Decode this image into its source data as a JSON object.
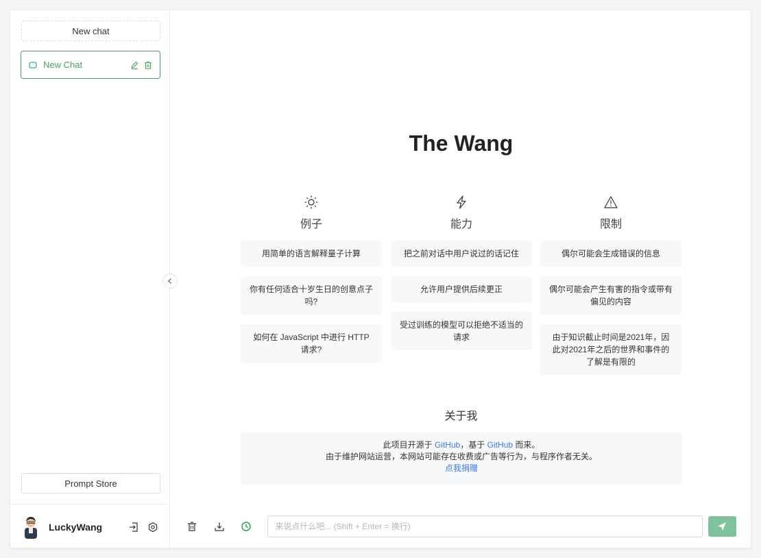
{
  "sidebar": {
    "new_chat_label": "New chat",
    "history": [
      {
        "label": "New Chat"
      }
    ],
    "prompt_store_label": "Prompt Store",
    "user": {
      "name": "LuckyWang"
    }
  },
  "main": {
    "title": "The Wang",
    "columns": [
      {
        "icon": "sun-icon",
        "title": "例子",
        "cards": [
          "用简单的语言解释量子计算",
          "你有任何适合十岁生日的创意点子吗?",
          "如何在 JavaScript 中进行 HTTP 请求?"
        ]
      },
      {
        "icon": "lightning-icon",
        "title": "能力",
        "cards": [
          "把之前对话中用户说过的话记住",
          "允许用户提供后续更正",
          "受过训练的模型可以拒绝不适当的请求"
        ]
      },
      {
        "icon": "warning-icon",
        "title": "限制",
        "cards": [
          "偶尔可能会生成错误的信息",
          "偶尔可能会产生有害的指令或带有偏见的内容",
          "由于知识截止时间是2021年，因此对2021年之后的世界和事件的了解是有限的"
        ]
      }
    ],
    "about": {
      "title": "关于我",
      "line1_prefix": "此项目开源于 ",
      "line1_link1": "GitHub",
      "line1_mid": "，基于 ",
      "line1_link2": "GitHub",
      "line1_suffix": " 而来。",
      "line2": "由于维护网站运营，本网站可能存在收费或广告等行为，与程序作者无关。",
      "donate_link": "点我捐赠"
    }
  },
  "footer": {
    "input_placeholder": "来说点什么吧... (Shift + Enter = 换行)",
    "input_value": ""
  },
  "colors": {
    "accent": "#4b9e5f",
    "send_button": "#7fc29b",
    "link": "#3d7be0"
  }
}
